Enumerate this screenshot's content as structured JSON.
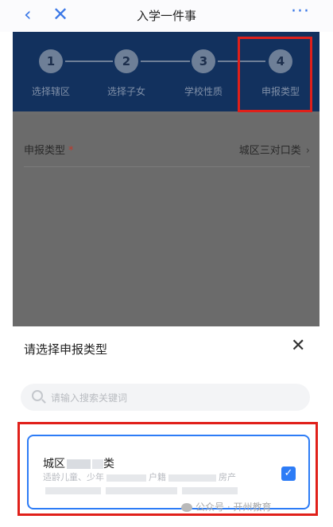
{
  "topbar": {
    "back_glyph": "‹",
    "close_glyph": "✕",
    "title": "入学一件事",
    "more_glyph": "···"
  },
  "steps": [
    {
      "number": "1",
      "label": "选择辖区"
    },
    {
      "number": "2",
      "label": "选择子女"
    },
    {
      "number": "3",
      "label": "学校性质"
    },
    {
      "number": "4",
      "label": "申报类型"
    }
  ],
  "form": {
    "label": "申报类型",
    "required_mark": "*",
    "value": "城区三对口类",
    "chevron": "›"
  },
  "sheet": {
    "title": "请选择申报类型",
    "close_glyph": "✕",
    "search_placeholder": "请输入搜索关键词",
    "option": {
      "title_prefix": "城区",
      "title_suffix": "类",
      "desc_start": "适龄儿童、少年",
      "desc_mid": "户籍",
      "desc_end": "房产",
      "desc_line2": "",
      "checked": true
    }
  },
  "watermark": {
    "text": "公众号 · 开州教育"
  },
  "colors": {
    "accent_blue": "#2d7cf6",
    "highlight_red": "#e0201a",
    "steps_band": "#12315e"
  }
}
